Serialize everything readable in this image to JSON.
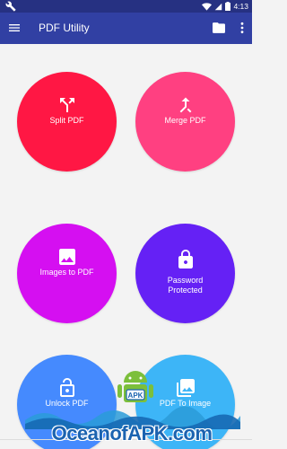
{
  "status_bar": {
    "time": "4:13",
    "icons": [
      "wrench-icon",
      "wifi-icon",
      "signal-icon",
      "battery-icon"
    ]
  },
  "app_bar": {
    "title": "PDF Utility",
    "icons": [
      "menu-icon",
      "folder-icon",
      "more-vert-icon"
    ]
  },
  "tiles": [
    {
      "label": "Split PDF",
      "icon": "split-icon",
      "color": "#ff1744"
    },
    {
      "label": "Merge PDF",
      "icon": "merge-icon",
      "color": "#ff4081"
    },
    {
      "label": "Images to PDF",
      "icon": "image-icon",
      "color": "#d50ff1"
    },
    {
      "label_line1": "Password",
      "label_line2": "Protected",
      "icon": "lock-icon",
      "color": "#6521f5"
    },
    {
      "label": "Unlock PDF",
      "icon": "unlock-icon",
      "color": "#458afe"
    },
    {
      "label": "PDF To Image",
      "icon": "image-icon",
      "color": "#3db5f7"
    }
  ],
  "watermark": {
    "badge_text": "APK",
    "text": "OceanofAPK.com"
  }
}
